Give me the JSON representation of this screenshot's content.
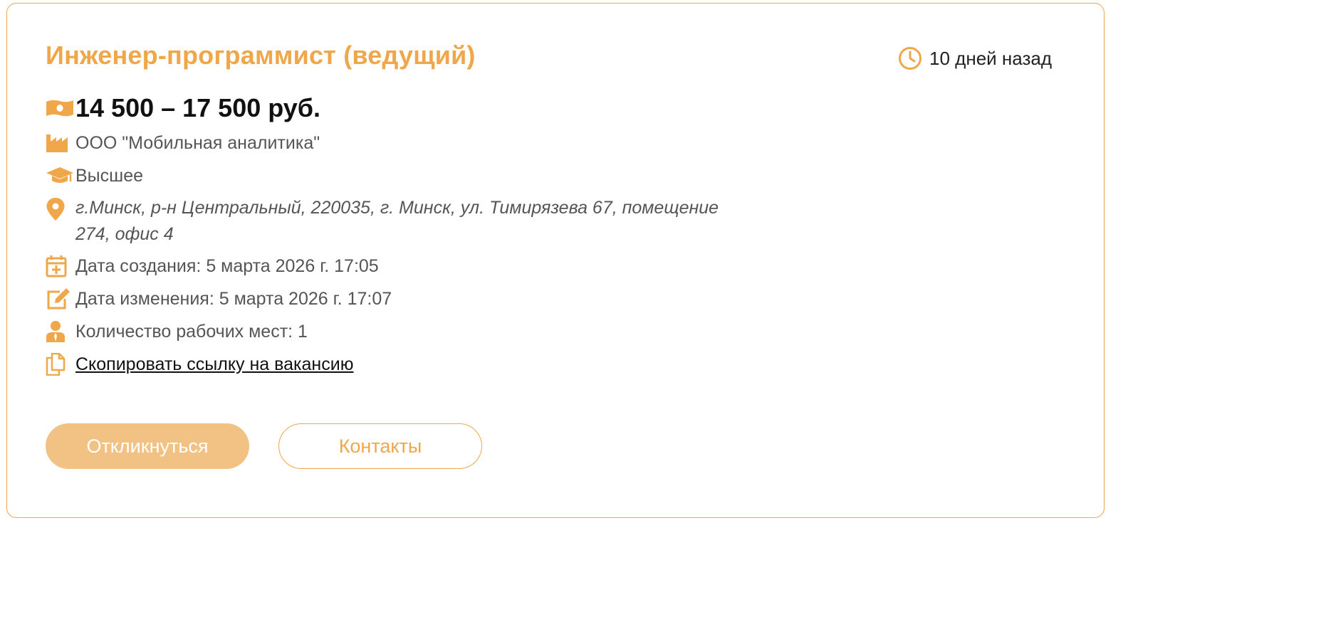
{
  "vacancy": {
    "title": "Инженер-программист (ведущий)",
    "posted_ago": "10 дней назад",
    "salary": "14 500 – 17 500 руб.",
    "company": "ООО \"Мобильная аналитика\"",
    "education": "Высшее",
    "address": "г.Минск, р-н Центральный, 220035, г. Минск, ул. Тимирязева 67, помещение 274, офис 4",
    "created": "Дата создания: 5 марта 2026 г. 17:05",
    "modified": "Дата изменения: 5 марта 2026 г. 17:07",
    "workplaces": "Количество рабочих мест: 1",
    "copy_link_label": "Скопировать ссылку на вакансию"
  },
  "actions": {
    "apply_label": "Откликнуться",
    "contacts_label": "Контакты"
  },
  "icons": {
    "posted": "clock-icon",
    "salary": "money-icon",
    "company": "factory-icon",
    "education": "graduation-cap-icon",
    "address": "map-pin-icon",
    "created": "calendar-plus-icon",
    "modified": "edit-icon",
    "workplaces": "user-icon",
    "copy": "copy-icon"
  },
  "colors": {
    "accent": "#efa749",
    "apply_button_bg": "#f2c285",
    "text_dark": "#111111",
    "text_muted": "#555555"
  }
}
